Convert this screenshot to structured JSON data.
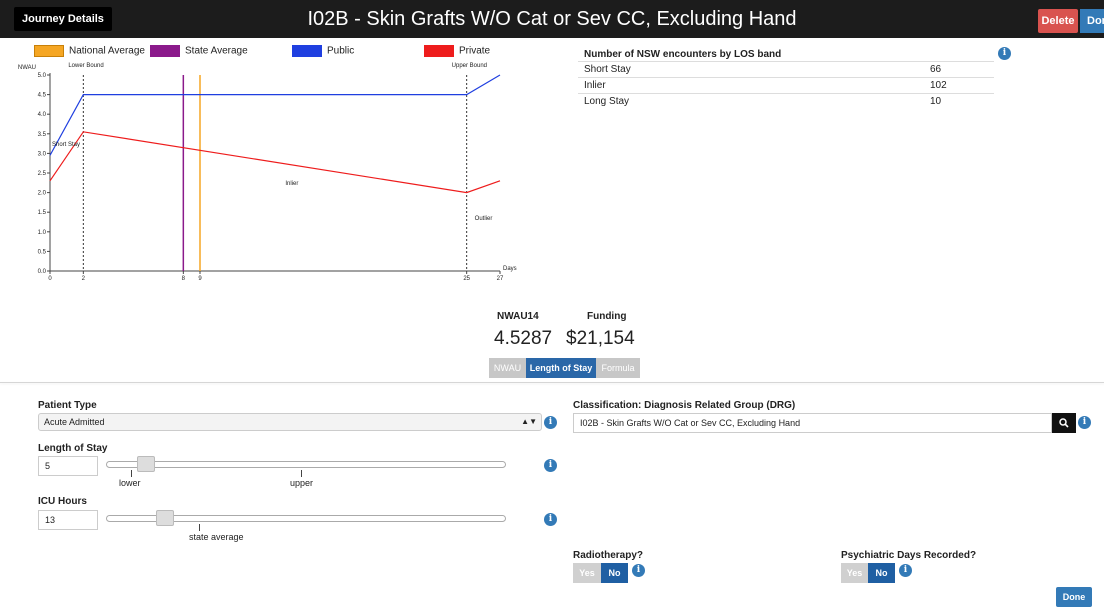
{
  "header": {
    "journey_label": "Journey Details",
    "title": "I02B - Skin Grafts W/O Cat or Sev CC, Excluding Hand",
    "delete_label": "Delete",
    "done_label": "Done"
  },
  "legend": [
    {
      "label": "National Average",
      "color": "#f5a623"
    },
    {
      "label": "State Average",
      "color": "#8b1a8b"
    },
    {
      "label": "Public",
      "color": "#1f3fe0"
    },
    {
      "label": "Private",
      "color": "#ee1c1c"
    }
  ],
  "chart_data": {
    "type": "line",
    "ylabel": "NWAU",
    "xlabel": "Days",
    "ylim": [
      0,
      5.0
    ],
    "xlim": [
      0,
      27
    ],
    "y_ticks": [
      "0.0",
      "0.5",
      "1.0",
      "1.5",
      "2.0",
      "2.5",
      "3.0",
      "3.5",
      "4.0",
      "4.5",
      "5.0"
    ],
    "x_ticks": [
      "0",
      "2",
      "8",
      "9",
      "25",
      "27"
    ],
    "series": [
      {
        "name": "Public",
        "color": "#1f3fe0",
        "points": [
          [
            0,
            2.95
          ],
          [
            2,
            4.5
          ],
          [
            25,
            4.5
          ],
          [
            27,
            5.0
          ]
        ]
      },
      {
        "name": "Private",
        "color": "#ee1c1c",
        "points": [
          [
            0,
            2.3
          ],
          [
            2,
            3.55
          ],
          [
            25,
            2.0
          ],
          [
            27,
            2.3
          ]
        ]
      }
    ],
    "vlines": [
      {
        "name": "State Average",
        "x": 8,
        "color": "#8b1a8b",
        "style": "solid"
      },
      {
        "name": "National Average",
        "x": 9,
        "color": "#f5a623",
        "style": "solid"
      },
      {
        "name": "Lower Bound",
        "x": 2,
        "color": "#333333",
        "style": "dashed"
      },
      {
        "name": "Upper Bound",
        "x": 25,
        "color": "#333333",
        "style": "dashed"
      }
    ],
    "annotations": [
      "Lower Bound",
      "Upper Bound",
      "Short Stay",
      "Inlier",
      "Outlier"
    ]
  },
  "encounters": {
    "title": "Number of NSW encounters by LOS band",
    "rows": [
      {
        "label": "Short Stay",
        "value": "66"
      },
      {
        "label": "Inlier",
        "value": "102"
      },
      {
        "label": "Long Stay",
        "value": "10"
      }
    ]
  },
  "metrics": {
    "nwau_label": "NWAU14",
    "nwau_value": "4.5287",
    "funding_label": "Funding",
    "funding_value": "$21,154"
  },
  "tabs": [
    {
      "label": "NWAU",
      "active": false
    },
    {
      "label": "Length of Stay",
      "active": true
    },
    {
      "label": "Formula",
      "active": false
    }
  ],
  "form": {
    "patient_type_label": "Patient Type",
    "patient_type_value": "Acute Admitted",
    "los_label": "Length of Stay",
    "los_value": "5",
    "los_slider_level": 0.08,
    "los_tick_lower": "lower",
    "los_tick_upper": "upper",
    "icu_label": "ICU Hours",
    "icu_value": "13",
    "icu_slider_level": 0.13,
    "icu_tick_state": "state average",
    "drg_label": "Classification: Diagnosis Related Group (DRG)",
    "drg_value": "I02B - Skin Grafts W/O Cat or Sev CC, Excluding Hand",
    "radio_label": "Radiotherapy?",
    "radio_yes": "Yes",
    "radio_no": "No",
    "psych_label": "Psychiatric Days Recorded?",
    "psych_yes": "Yes",
    "psych_no": "No",
    "done_label": "Done"
  },
  "colors": {
    "accent": "#337ab7",
    "danger": "#d9534f",
    "topbar": "#1c1c1c"
  }
}
